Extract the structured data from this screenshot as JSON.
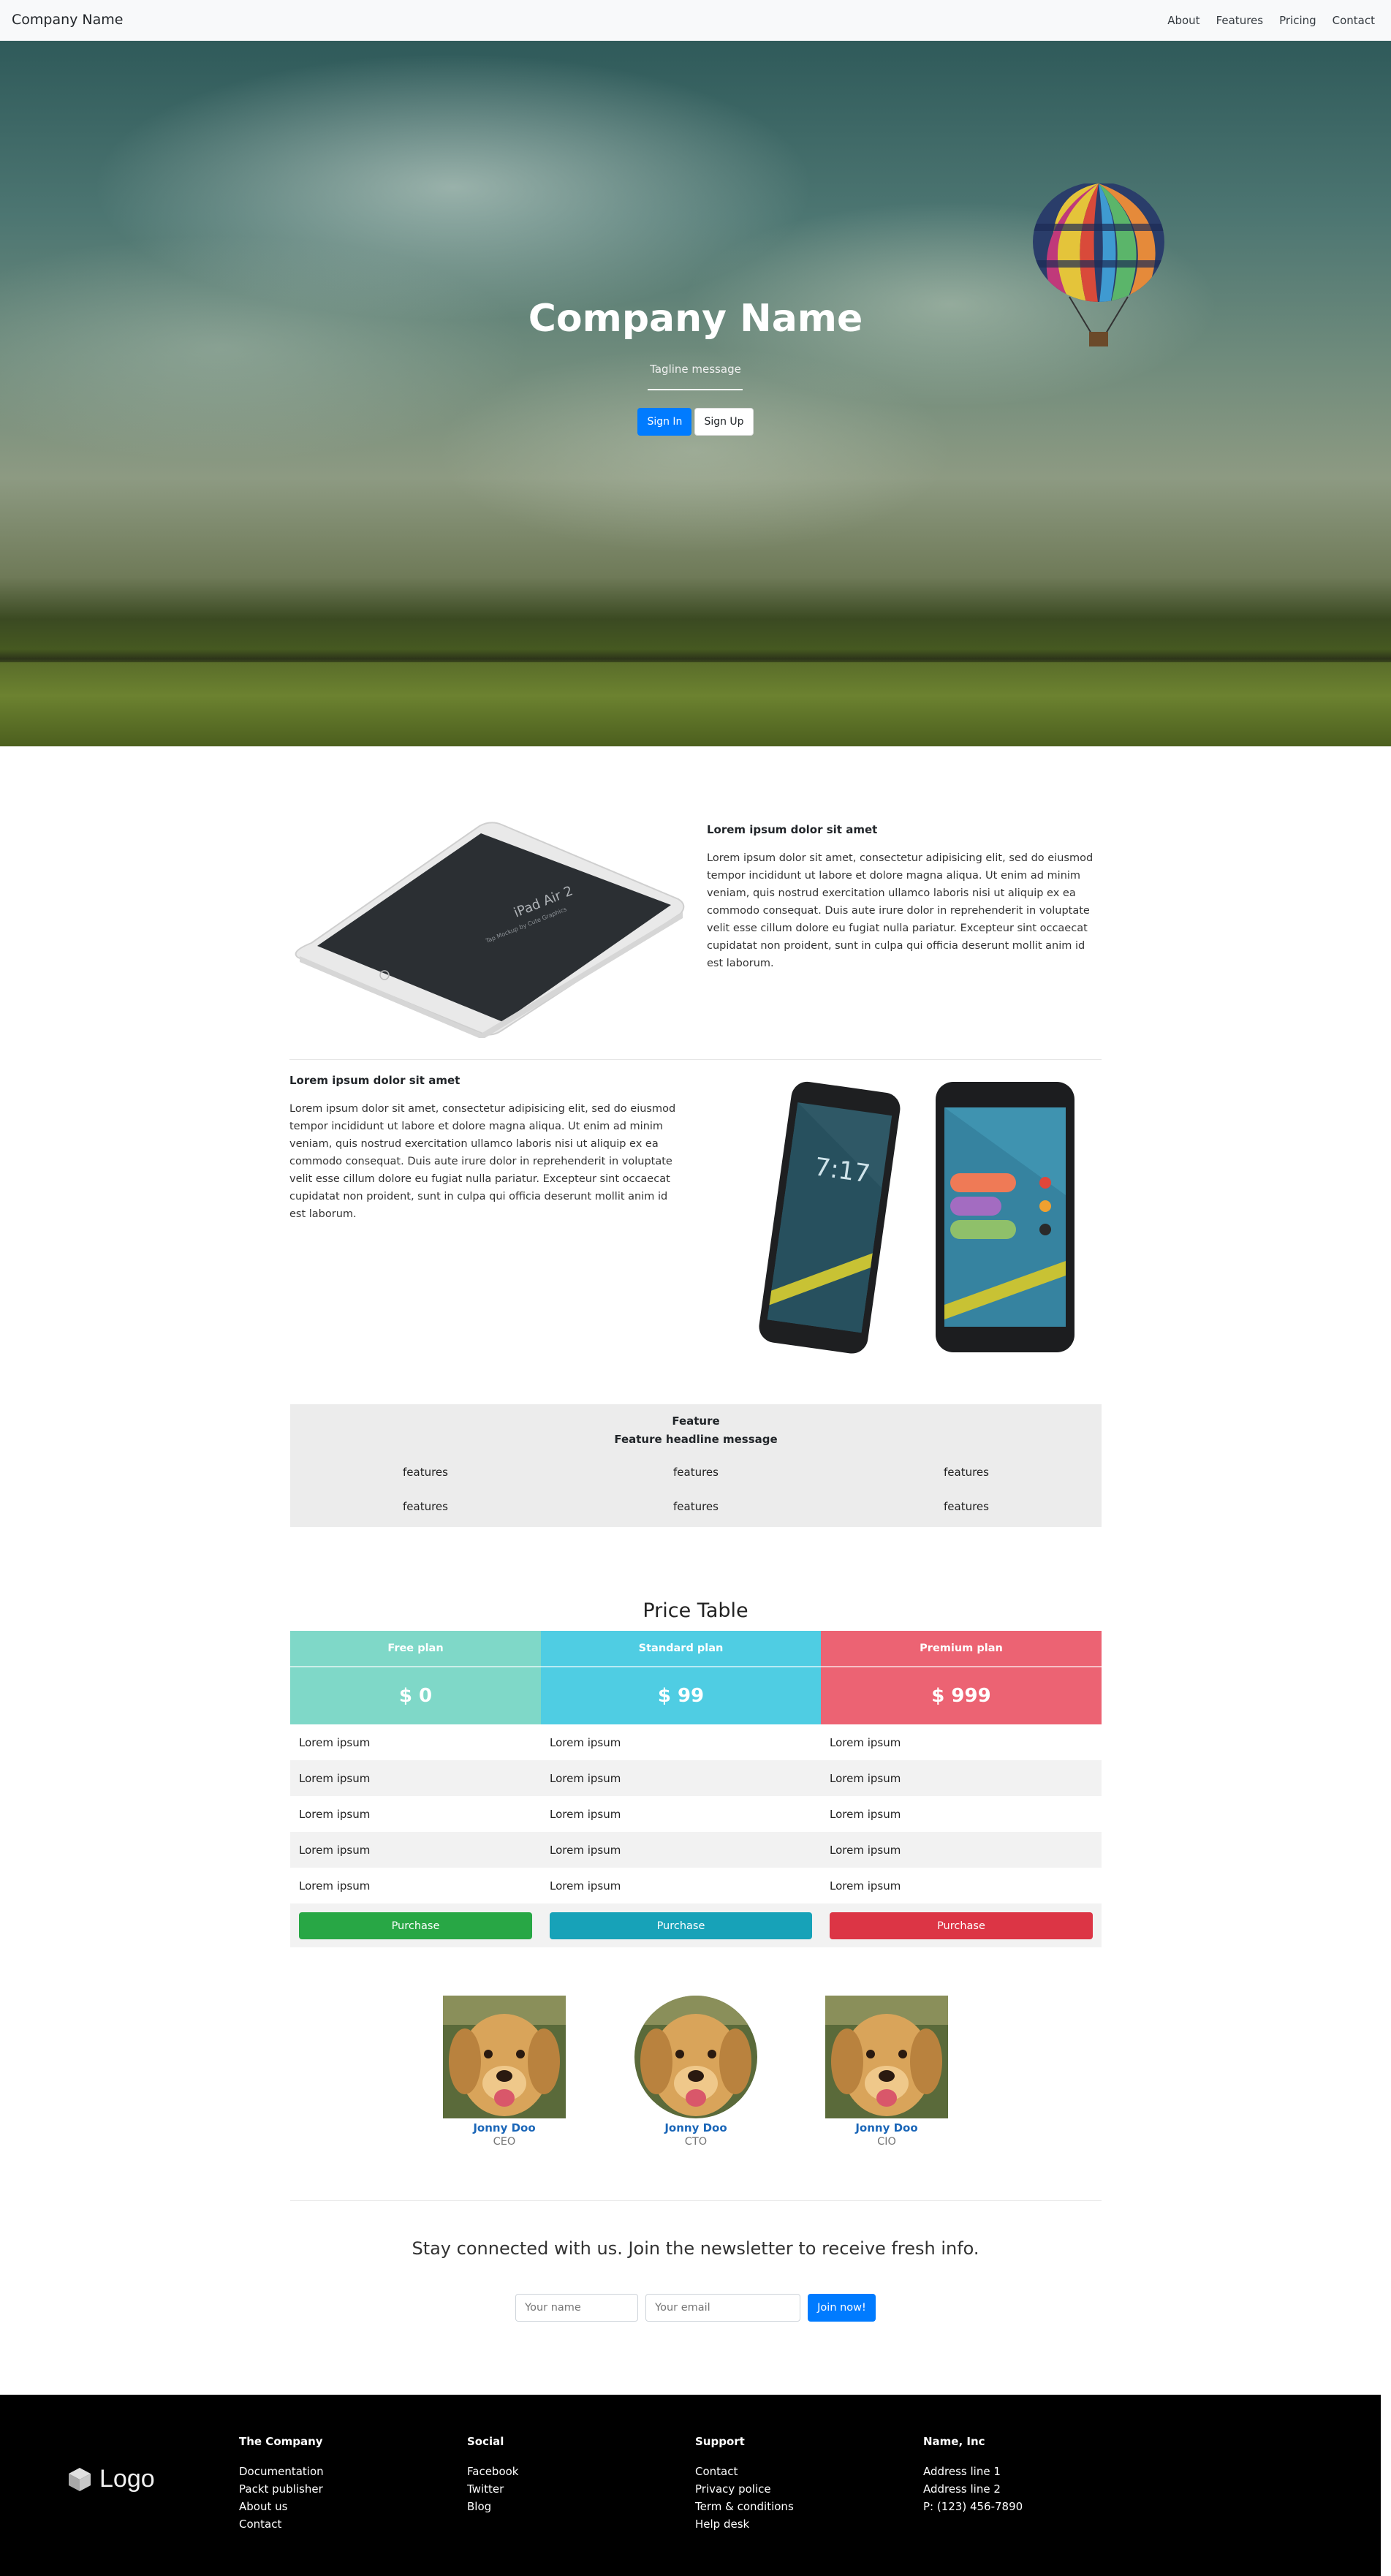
{
  "navbar": {
    "brand": "Company Name",
    "links": [
      "About",
      "Features",
      "Pricing",
      "Contact"
    ]
  },
  "hero": {
    "title": "Company Name",
    "tagline": "Tagline message",
    "signin_label": "Sign In",
    "signup_label": "Sign Up"
  },
  "features": [
    {
      "title": "Lorem ipsum dolor sit amet",
      "body": "Lorem ipsum dolor sit amet, consectetur adipisicing elit, sed do eiusmod tempor incididunt ut labore et dolore magna aliqua. Ut enim ad minim veniam, quis nostrud exercitation ullamco laboris nisi ut aliquip ex ea commodo consequat. Duis aute irure dolor in reprehenderit in voluptate velit esse cillum dolore eu fugiat nulla pariatur. Excepteur sint occaecat cupidatat non proident, sunt in culpa qui officia deserunt mollit anim id est laborum.",
      "image_text": "iPad Air 2",
      "image_subtext": "Tap Mockup by Cute Graphics"
    },
    {
      "title": "Lorem ipsum dolor sit amet",
      "body": "Lorem ipsum dolor sit amet, consectetur adipisicing elit, sed do eiusmod tempor incididunt ut labore et dolore magna aliqua. Ut enim ad minim veniam, quis nostrud exercitation ullamco laboris nisi ut aliquip ex ea commodo consequat. Duis aute irure dolor in reprehenderit in voluptate velit esse cillum dolore eu fugiat nulla pariatur. Excepteur sint occaecat cupidatat non proident, sunt in culpa qui officia deserunt mollit anim id est laborum.",
      "phone_time": "7:17"
    }
  ],
  "feature_grid": {
    "title": "Feature",
    "subtitle": "Feature headline message",
    "rows": [
      [
        "features",
        "features",
        "features"
      ],
      [
        "features",
        "features",
        "features"
      ]
    ]
  },
  "pricing": {
    "title": "Price Table",
    "plans": [
      {
        "name": "Free plan",
        "price": "$ 0",
        "color": "#7fd8c8",
        "button": "Purchase",
        "button_color": "#28a745"
      },
      {
        "name": "Standard plan",
        "price": "$ 99",
        "color": "#4fcde3",
        "button": "Purchase",
        "button_color": "#17a2b8"
      },
      {
        "name": "Premium plan",
        "price": "$ 999",
        "color": "#ec6373",
        "button": "Purchase",
        "button_color": "#dc3545"
      }
    ],
    "rows": [
      [
        "Lorem ipsum",
        "Lorem ipsum",
        "Lorem ipsum"
      ],
      [
        "Lorem ipsum",
        "Lorem ipsum",
        "Lorem ipsum"
      ],
      [
        "Lorem ipsum",
        "Lorem ipsum",
        "Lorem ipsum"
      ],
      [
        "Lorem ipsum",
        "Lorem ipsum",
        "Lorem ipsum"
      ],
      [
        "Lorem ipsum",
        "Lorem ipsum",
        "Lorem ipsum"
      ]
    ]
  },
  "team": [
    {
      "name": "Jonny Doo",
      "role": "CEO"
    },
    {
      "name": "Jonny Doo",
      "role": "CTO"
    },
    {
      "name": "Jonny Doo",
      "role": "CIO"
    }
  ],
  "newsletter": {
    "text": "Stay connected with us. Join the newsletter to receive fresh info.",
    "name_placeholder": "Your name",
    "email_placeholder": "Your email",
    "button": "Join now!"
  },
  "footer": {
    "logo": "Logo",
    "columns": [
      {
        "title": "The Company",
        "items": [
          "Documentation",
          "Packt publisher",
          "About us",
          "Contact"
        ]
      },
      {
        "title": "Social",
        "items": [
          "Facebook",
          "Twitter",
          "Blog"
        ]
      },
      {
        "title": "Support",
        "items": [
          "Contact",
          "Privacy police",
          "Term & conditions",
          "Help desk"
        ]
      },
      {
        "title": "Name, Inc",
        "items": [
          "Address line 1",
          "Address line 2",
          "P: (123) 456-7890"
        ]
      }
    ]
  }
}
